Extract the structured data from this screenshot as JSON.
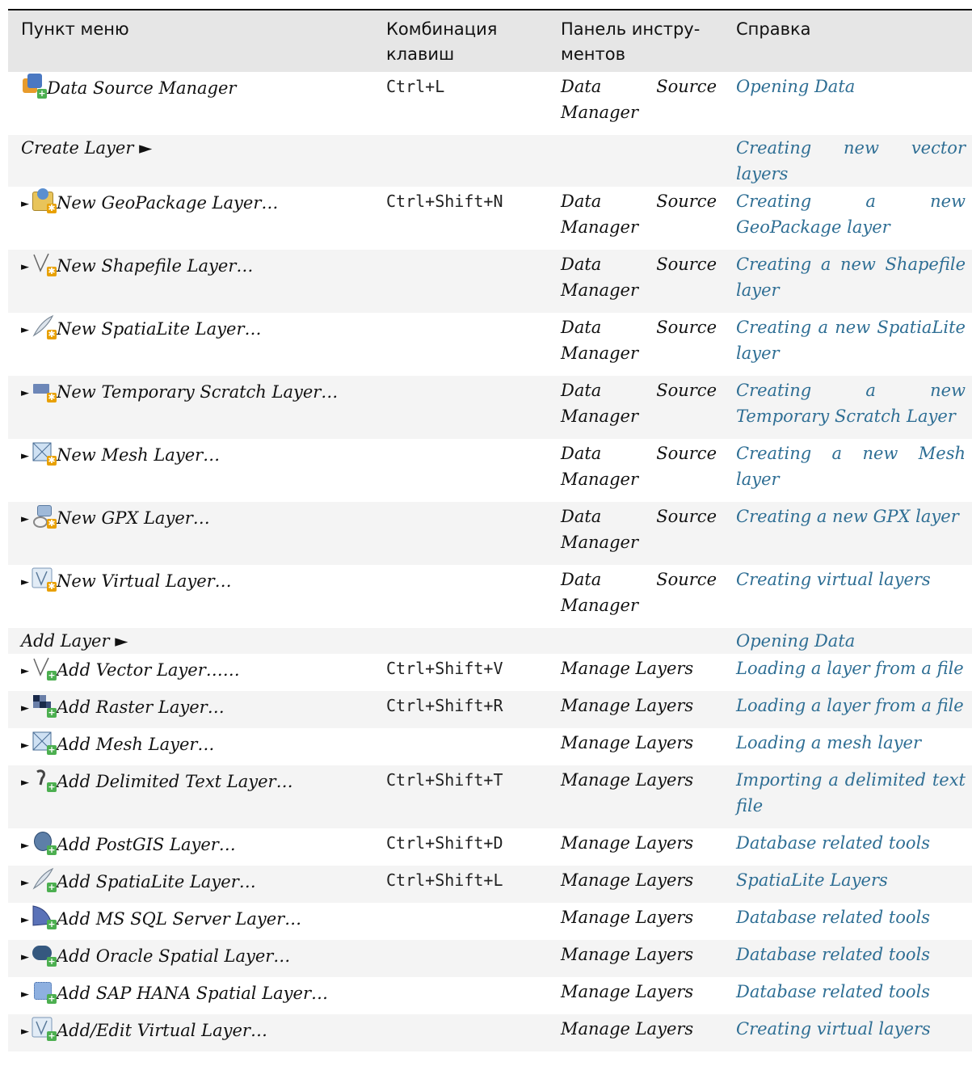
{
  "headers": [
    "Пункт меню",
    "Комбинация клавиш",
    "Панель инстру-ментов",
    "Справка"
  ],
  "rows": [
    {
      "item": "Data Source Manager",
      "sub": false,
      "icon": "data-source-manager-icon",
      "shortcut": "Ctrl+L",
      "toolbar": "Data Source Manager",
      "help": "Opening Data"
    },
    {
      "item": "Create Layer ►",
      "sub": false,
      "icon": "",
      "shortcut": "",
      "toolbar": "",
      "help": "Creating new vector layers"
    },
    {
      "item": "New GeoPackage Layer…",
      "sub": true,
      "icon": "new-geopackage-icon",
      "shortcut": "Ctrl+Shift+N",
      "toolbar": "Data Source Manager",
      "help": "Creating a new GeoPackage layer"
    },
    {
      "item": "New Shapefile Layer…",
      "sub": true,
      "icon": "new-shapefile-icon",
      "shortcut": "",
      "toolbar": "Data Source Manager",
      "help": "Creating a new Shapefile layer"
    },
    {
      "item": "New SpatiaLite Layer…",
      "sub": true,
      "icon": "new-spatialite-icon",
      "shortcut": "",
      "toolbar": "Data Source Manager",
      "help": "Creating a new SpatiaLite layer"
    },
    {
      "item": "New Temporary Scratch Layer…",
      "sub": true,
      "icon": "new-scratch-layer-icon",
      "shortcut": "",
      "toolbar": "Data Source Manager",
      "help": "Creating a new Temporary Scratch Layer"
    },
    {
      "item": "New Mesh Layer…",
      "sub": true,
      "icon": "new-mesh-icon",
      "shortcut": "",
      "toolbar": "Data Source Manager",
      "help": "Creating a new Mesh layer"
    },
    {
      "item": "New GPX Layer…",
      "sub": true,
      "icon": "new-gpx-icon",
      "shortcut": "",
      "toolbar": "Data Source Manager",
      "help": "Creating a new GPX layer"
    },
    {
      "item": "New Virtual Layer…",
      "sub": true,
      "icon": "new-virtual-icon",
      "shortcut": "",
      "toolbar": "Data Source Manager",
      "help": "Creating virtual layers"
    },
    {
      "item": "Add Layer ►",
      "sub": false,
      "icon": "",
      "shortcut": "",
      "toolbar": "",
      "help": "Opening Data"
    },
    {
      "item": "Add Vector Layer……",
      "sub": true,
      "icon": "add-vector-icon",
      "shortcut": "Ctrl+Shift+V",
      "toolbar": "Manage Layers",
      "help": "Loading a layer from a file"
    },
    {
      "item": "Add Raster Layer…",
      "sub": true,
      "icon": "add-raster-icon",
      "shortcut": "Ctrl+Shift+R",
      "toolbar": "Manage Layers",
      "help": "Loading a layer from a file"
    },
    {
      "item": "Add Mesh Layer…",
      "sub": true,
      "icon": "add-mesh-icon",
      "shortcut": "",
      "toolbar": "Manage Layers",
      "help": "Loading a mesh layer"
    },
    {
      "item": "Add Delimited Text Layer…",
      "sub": true,
      "icon": "add-delimited-text-icon",
      "shortcut": "Ctrl+Shift+T",
      "toolbar": "Manage Layers",
      "help": "Importing a delimited text file"
    },
    {
      "item": "Add PostGIS Layer…",
      "sub": true,
      "icon": "add-postgis-icon",
      "shortcut": "Ctrl+Shift+D",
      "toolbar": "Manage Layers",
      "help": "Database related tools"
    },
    {
      "item": "Add SpatiaLite Layer…",
      "sub": true,
      "icon": "add-spatialite-icon",
      "shortcut": "Ctrl+Shift+L",
      "toolbar": "Manage Layers",
      "help": "SpatiaLite Layers"
    },
    {
      "item": "Add MS SQL Server Layer…",
      "sub": true,
      "icon": "add-mssql-icon",
      "shortcut": "",
      "toolbar": "Manage Layers",
      "help": "Database related tools"
    },
    {
      "item": "Add Oracle Spatial Layer…",
      "sub": true,
      "icon": "add-oracle-icon",
      "shortcut": "",
      "toolbar": "Manage Layers",
      "help": "Database related tools"
    },
    {
      "item": "Add SAP HANA Spatial Layer…",
      "sub": true,
      "icon": "add-hana-icon",
      "shortcut": "",
      "toolbar": "Manage Layers",
      "help": "Database related tools"
    },
    {
      "item": "Add/Edit Virtual Layer…",
      "sub": true,
      "icon": "add-virtual-icon",
      "shortcut": "",
      "toolbar": "Manage Layers",
      "help": "Creating virtual layers"
    }
  ],
  "link_color": "#2e6e94"
}
